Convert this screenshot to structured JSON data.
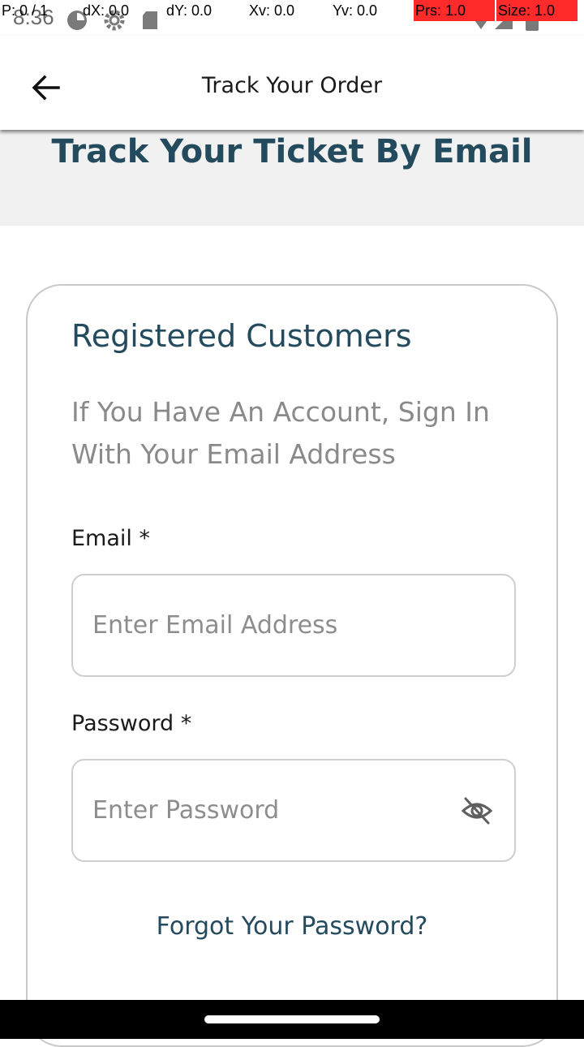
{
  "status_bar": {
    "time": "8:36",
    "debug": {
      "p": "P: 0 / 1",
      "dx": "dX: 0.0",
      "dy": "dY: 0.0",
      "xv": "Xv: 0.0",
      "yv": "Yv: 0.0",
      "prs": "Prs: 1.0",
      "size": "Size: 1.0"
    },
    "icons": [
      "sync-icon",
      "settings-icon",
      "sd-card-icon",
      "wifi-icon",
      "signal-icon",
      "battery-icon"
    ]
  },
  "app_bar": {
    "title": "Track Your Order",
    "back_icon": "arrow-back-icon"
  },
  "header": {
    "title": "Track Your Ticket By Email"
  },
  "login_card": {
    "title": "Registered Customers",
    "subtitle": "If You Have An Account, Sign In With Your Email Address",
    "email": {
      "label": "Email *",
      "placeholder": "Enter Email Address",
      "value": ""
    },
    "password": {
      "label": "Password *",
      "placeholder": "Enter Password",
      "value": "",
      "toggle_icon": "eye-off-icon"
    },
    "forgot_link": "Forgot Your Password?"
  },
  "colors": {
    "accent": "#244a5e",
    "header_band": "#f1f1f1",
    "muted_text": "#8a8a8a",
    "debug_red": "#ff2a2a"
  }
}
